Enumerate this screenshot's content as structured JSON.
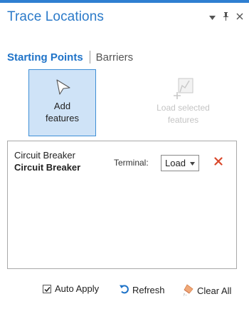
{
  "header": {
    "title": "Trace Locations",
    "icons": [
      "dropdown-icon",
      "pin-icon",
      "close-icon"
    ],
    "accent_color": "#2f7fd1"
  },
  "tabs": {
    "active": "Starting Points",
    "inactive": "Barriers"
  },
  "tools": {
    "add": {
      "label_line1": "Add",
      "label_line2": "features",
      "icon": "arrow-cursor-icon"
    },
    "load": {
      "label_line1": "Load selected",
      "label_line2": "features",
      "icon": "load-selected-icon",
      "enabled": false
    }
  },
  "list": {
    "rows": [
      {
        "name_line1": "Circuit Breaker",
        "name_line2": "Circuit Breaker",
        "terminal_label": "Terminal:",
        "terminal_value": "Load"
      }
    ]
  },
  "footer": {
    "auto_apply_label": "Auto Apply",
    "auto_apply_checked": true,
    "refresh_label": "Refresh",
    "clear_all_label": "Clear All"
  },
  "colors": {
    "remove": "#d9482b",
    "active_tab": "#1f73c8",
    "selected_tile_bg": "#cfe3f7"
  }
}
